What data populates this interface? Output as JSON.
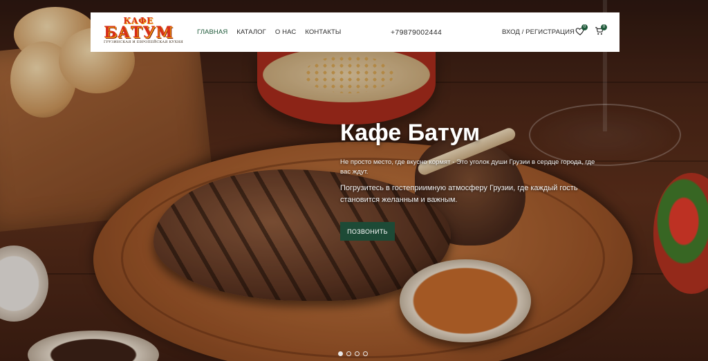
{
  "header": {
    "logo": {
      "top": "КАФЕ",
      "main": "БАТУМ",
      "sub": "ГРУЗИНСКАЯ И ЕВРОПЕЙСКАЯ КУХНЯ"
    },
    "nav": [
      {
        "label": "Главная",
        "active": true
      },
      {
        "label": "Каталог",
        "active": false
      },
      {
        "label": "О нас",
        "active": false
      },
      {
        "label": "Контакты",
        "active": false
      }
    ],
    "phone": "+79879002444",
    "login": "ВХОД / РЕГИСТРАЦИЯ",
    "wishlist_count": "0",
    "cart_count": "0"
  },
  "hero": {
    "title": "Кафе Батум",
    "paragraph1": "Не просто место, где вкусно кормят - Это уголок души Грузии в сердце города, где вас ждут.",
    "paragraph2": "Погрузитесь в гостеприимную атмосферу Грузии, где каждый гость становится желанным и важным.",
    "cta": "Позвонить"
  },
  "slider": {
    "slide_count": 4,
    "active_index": 0
  },
  "colors": {
    "accent": "#1d4a36",
    "logo_red": "#d62f1a",
    "logo_gold": "#f2b20a"
  }
}
